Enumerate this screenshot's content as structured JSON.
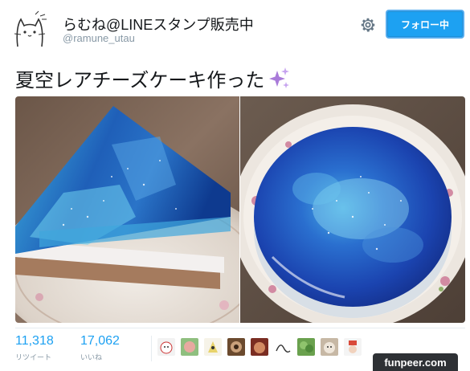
{
  "user": {
    "display_name": "らむね@LINEスタンプ販売中",
    "handle": "@ramune_utau"
  },
  "follow_button": {
    "label": "フォロー中"
  },
  "tweet": {
    "text": "夏空レアチーズケーキ作った",
    "emoji_icon": "sparkles-icon"
  },
  "media": {
    "photos": [
      {
        "name": "cheesecake-slice-photo"
      },
      {
        "name": "cheesecake-whole-photo"
      }
    ]
  },
  "stats": {
    "retweets": {
      "value": "11,318",
      "label": "リツイート"
    },
    "likes": {
      "value": "17,062",
      "label": "いいね"
    }
  },
  "watermark": {
    "text": "funpeer.com"
  },
  "colors": {
    "accent": "#1da1f2",
    "text": "#14171a",
    "muted": "#8899a6"
  }
}
